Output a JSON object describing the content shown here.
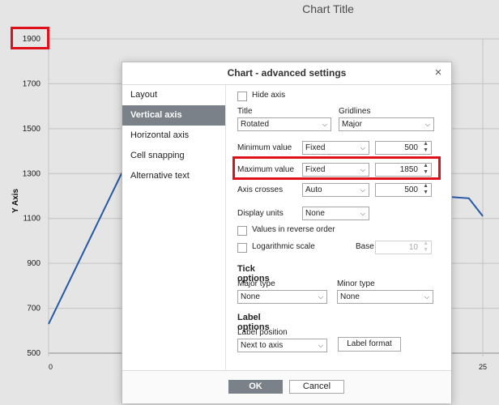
{
  "chart": {
    "title": "Chart Title",
    "y_axis_title": "Y Axis",
    "x_tick_labels": [
      "0",
      "25"
    ],
    "line_color": "#2b63b8"
  },
  "chart_data": {
    "type": "line",
    "title": "Chart Title",
    "ylabel": "Y Axis",
    "xlabel": "",
    "ylim": [
      500,
      1900
    ],
    "y_ticks": [
      500,
      700,
      900,
      1100,
      1300,
      1500,
      1700,
      1900
    ],
    "x_ticks": [
      0,
      25
    ],
    "grid": true,
    "series": [
      {
        "x": [
          0,
          4.2,
          24.2,
          25
        ],
        "y": [
          630,
          1300,
          1190,
          1110
        ]
      }
    ]
  },
  "dialog": {
    "title": "Chart - advanced settings",
    "close_icon": "×",
    "nav": [
      "Layout",
      "Vertical axis",
      "Horizontal axis",
      "Cell snapping",
      "Alternative text"
    ],
    "active_nav": "Vertical axis",
    "hide_axis_label": "Hide axis",
    "title_label": "Title",
    "title_value": "Rotated",
    "gridlines_label": "Gridlines",
    "gridlines_value": "Major",
    "min_label": "Minimum value",
    "min_mode": "Fixed",
    "min_value": "500",
    "max_label": "Maximum value",
    "max_mode": "Fixed",
    "max_value": "1850",
    "crosses_label": "Axis crosses",
    "crosses_mode": "Auto",
    "crosses_value": "500",
    "units_label": "Display units",
    "units_value": "None",
    "reverse_label": "Values in reverse order",
    "log_label": "Logarithmic scale",
    "base_label": "Base",
    "base_value": "10",
    "tick_section": "Tick options",
    "major_type_label": "Major type",
    "major_type_value": "None",
    "minor_type_label": "Minor type",
    "minor_type_value": "None",
    "label_section": "Label options",
    "label_position_label": "Label position",
    "label_position_value": "Next to axis",
    "label_format_button": "Label format",
    "ok": "OK",
    "cancel": "Cancel",
    "chevron_glyph": "⌵",
    "spin_glyph_up": "▲",
    "spin_glyph_down": "▼"
  },
  "highlight_color": "#e0101a"
}
